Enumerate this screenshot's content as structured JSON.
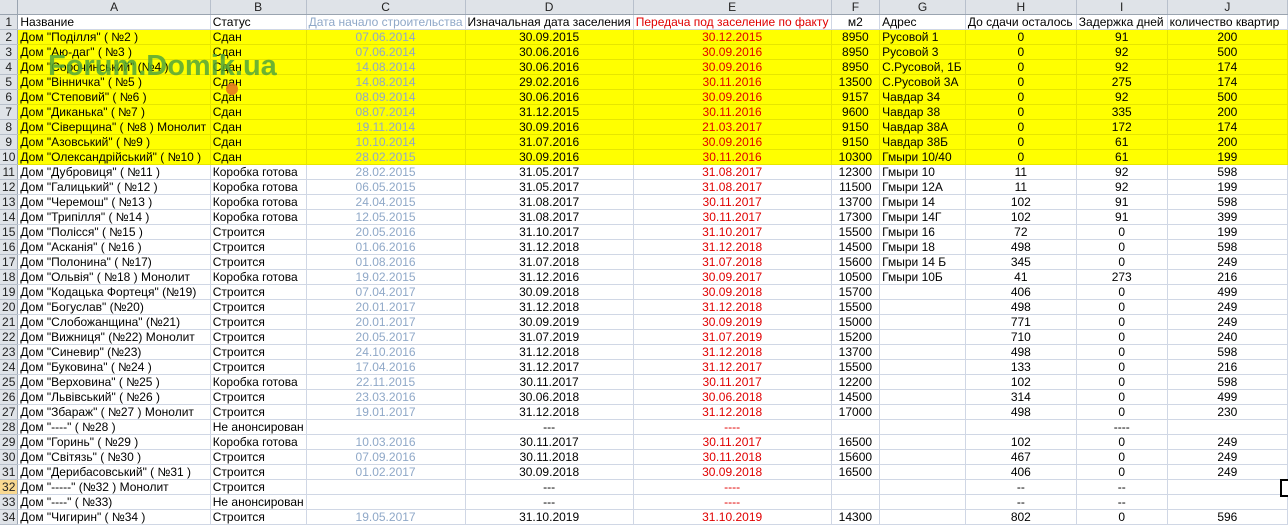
{
  "columns": [
    "A",
    "B",
    "C",
    "D",
    "E",
    "F",
    "G",
    "H",
    "I",
    "J"
  ],
  "headers": [
    "Название",
    "Статус",
    "Дата начало строительства",
    "Изначальная дата заселения",
    "Передача под заселение по факту",
    "м2",
    "Адрес",
    "До сдачи осталось",
    "Задержка дней",
    "количество квартир"
  ],
  "watermark": "Forum.Domik.ua",
  "selected_row": 32,
  "rows": [
    {
      "n": 2,
      "name": "Дом \"Поділля\" ( №2 )",
      "status": "Сдан",
      "start": "07.06.2014",
      "plan": "30.09.2015",
      "fact": "30.12.2015",
      "m2": "8950",
      "addr": "Русовой 1",
      "left": "0",
      "delay": "91",
      "flats": "200",
      "yellow": true
    },
    {
      "n": 3,
      "name": "Дом \"Аю-даг\" ( №3 )",
      "status": "Сдан",
      "start": "07.06.2014",
      "plan": "30.06.2016",
      "fact": "30.09.2016",
      "m2": "8950",
      "addr": "Русовой 3",
      "left": "0",
      "delay": "92",
      "flats": "500",
      "yellow": true
    },
    {
      "n": 4,
      "name": "Дом \"Сорочинський\" (№4 )",
      "status": "Сдан",
      "start": "14.08.2014",
      "plan": "30.06.2016",
      "fact": "30.09.2016",
      "m2": "8950",
      "addr": "С.Русовой, 1Б",
      "left": "0",
      "delay": "92",
      "flats": "174",
      "yellow": true
    },
    {
      "n": 5,
      "name": "Дом \"Вінничка\" ( №5 )",
      "status": "Сдан",
      "start": "14.08.2014",
      "plan": "29.02.2016",
      "fact": "30.11.2016",
      "m2": "13500",
      "addr": "С.Русовой 3А",
      "left": "0",
      "delay": "275",
      "flats": "174",
      "yellow": true
    },
    {
      "n": 6,
      "name": "Дом \"Степовий\" ( №6 )",
      "status": "Сдан",
      "start": "08.09.2014",
      "plan": "30.06.2016",
      "fact": "30.09.2016",
      "m2": "9157",
      "addr": "Чавдар 34",
      "left": "0",
      "delay": "92",
      "flats": "500",
      "yellow": true
    },
    {
      "n": 7,
      "name": "Дом \"Диканька\" ( №7 )",
      "status": "Сдан",
      "start": "08.07.2014",
      "plan": "31.12.2015",
      "fact": "30.11.2016",
      "m2": "9600",
      "addr": "Чавдар 38",
      "left": "0",
      "delay": "335",
      "flats": "200",
      "yellow": true
    },
    {
      "n": 8,
      "name": "Дом \"Сіверщина\" ( №8 ) Монолит",
      "status": "Сдан",
      "start": "19.11.2014",
      "plan": "30.09.2016",
      "fact": "21.03.2017",
      "m2": "9150",
      "addr": "Чавдар 38А",
      "left": "0",
      "delay": "172",
      "flats": "174",
      "yellow": true
    },
    {
      "n": 9,
      "name": "Дом \"Азовський\" ( №9 )",
      "status": "Сдан",
      "start": "10.10.2014",
      "plan": "31.07.2016",
      "fact": "30.09.2016",
      "m2": "9150",
      "addr": "Чавдар 38Б",
      "left": "0",
      "delay": "61",
      "flats": "200",
      "yellow": true
    },
    {
      "n": 10,
      "name": "Дом \"Олександрійський\" ( №10 )",
      "status": "Сдан",
      "start": "28.02.2015",
      "plan": "30.09.2016",
      "fact": "30.11.2016",
      "m2": "10300",
      "addr": "Гмыри 10/40",
      "left": "0",
      "delay": "61",
      "flats": "199",
      "yellow": true
    },
    {
      "n": 11,
      "name": "Дом \"Дубровиця\" ( №11 )",
      "status": "Коробка готова",
      "start": "28.02.2015",
      "plan": "31.05.2017",
      "fact": "31.08.2017",
      "m2": "12300",
      "addr": "Гмыри 10",
      "left": "11",
      "delay": "92",
      "flats": "598",
      "yellow": false
    },
    {
      "n": 12,
      "name": "Дом \"Галицький\" ( №12 )",
      "status": "Коробка готова",
      "start": "06.05.2015",
      "plan": "31.05.2017",
      "fact": "31.08.2017",
      "m2": "11500",
      "addr": "Гмыри 12А",
      "left": "11",
      "delay": "92",
      "flats": "199",
      "yellow": false
    },
    {
      "n": 13,
      "name": "Дом \"Черемош\" ( №13 )",
      "status": "Коробка готова",
      "start": "24.04.2015",
      "plan": "31.08.2017",
      "fact": "30.11.2017",
      "m2": "13700",
      "addr": "Гмыри 14",
      "left": "102",
      "delay": "91",
      "flats": "598",
      "yellow": false
    },
    {
      "n": 14,
      "name": "Дом \"Трипілля\" ( №14 )",
      "status": "Коробка готова",
      "start": "12.05.2015",
      "plan": "31.08.2017",
      "fact": "30.11.2017",
      "m2": "17300",
      "addr": "Гмыри 14Г",
      "left": "102",
      "delay": "91",
      "flats": "399",
      "yellow": false
    },
    {
      "n": 15,
      "name": "Дом \"Полісся\" ( №15 )",
      "status": "Строится",
      "start": "20.05.2016",
      "plan": "31.10.2017",
      "fact": "31.10.2017",
      "m2": "15500",
      "addr": "Гмыри 16",
      "left": "72",
      "delay": "0",
      "flats": "199",
      "yellow": false
    },
    {
      "n": 16,
      "name": "Дом \"Асканія\" ( №16 )",
      "status": "Строится",
      "start": "01.06.2016",
      "plan": "31.12.2018",
      "fact": "31.12.2018",
      "m2": "14500",
      "addr": "Гмыри 18",
      "left": "498",
      "delay": "0",
      "flats": "598",
      "yellow": false
    },
    {
      "n": 17,
      "name": "Дом \"Полонина\" ( №17)",
      "status": "Строится",
      "start": "01.08.2016",
      "plan": "31.07.2018",
      "fact": "31.07.2018",
      "m2": "15600",
      "addr": "Гмыри 14 Б",
      "left": "345",
      "delay": "0",
      "flats": "249",
      "yellow": false
    },
    {
      "n": 18,
      "name": "Дом \"Ольвія\" ( №18 ) Монолит",
      "status": "Коробка готова",
      "start": "19.02.2015",
      "plan": "31.12.2016",
      "fact": "30.09.2017",
      "m2": "10500",
      "addr": "Гмыри 10Б",
      "left": "41",
      "delay": "273",
      "flats": "216",
      "yellow": false
    },
    {
      "n": 19,
      "name": "Дом \"Кодацька Фортеця\" (№19)",
      "status": "Строится",
      "start": "07.04.2017",
      "plan": "30.09.2018",
      "fact": "30.09.2018",
      "m2": "15700",
      "addr": "",
      "left": "406",
      "delay": "0",
      "flats": "499",
      "yellow": false
    },
    {
      "n": 20,
      "name": "Дом \"Богуслав\" (№20)",
      "status": "Строится",
      "start": "20.01.2017",
      "plan": "31.12.2018",
      "fact": "31.12.2018",
      "m2": "15500",
      "addr": "",
      "left": "498",
      "delay": "0",
      "flats": "249",
      "yellow": false
    },
    {
      "n": 21,
      "name": "Дом \"Слобожанщина\" (№21)",
      "status": "Строится",
      "start": "20.01.2017",
      "plan": "30.09.2019",
      "fact": "30.09.2019",
      "m2": "15000",
      "addr": "",
      "left": "771",
      "delay": "0",
      "flats": "249",
      "yellow": false
    },
    {
      "n": 22,
      "name": "Дом \"Вижниця\" (№22) Монолит",
      "status": "Строится",
      "start": "20.05.2017",
      "plan": "31.07.2019",
      "fact": "31.07.2019",
      "m2": "15200",
      "addr": "",
      "left": "710",
      "delay": "0",
      "flats": "240",
      "yellow": false
    },
    {
      "n": 23,
      "name": "Дом \"Синевир\" (№23)",
      "status": "Строится",
      "start": "24.10.2016",
      "plan": "31.12.2018",
      "fact": "31.12.2018",
      "m2": "13700",
      "addr": "",
      "left": "498",
      "delay": "0",
      "flats": "598",
      "yellow": false
    },
    {
      "n": 24,
      "name": "Дом \"Буковина\" ( №24 )",
      "status": "Строится",
      "start": "17.04.2016",
      "plan": "31.12.2017",
      "fact": "31.12.2017",
      "m2": "15500",
      "addr": "",
      "left": "133",
      "delay": "0",
      "flats": "216",
      "yellow": false
    },
    {
      "n": 25,
      "name": "Дом \"Верховина\" ( №25 )",
      "status": "Коробка готова",
      "start": "22.11.2015",
      "plan": "30.11.2017",
      "fact": "30.11.2017",
      "m2": "12200",
      "addr": "",
      "left": "102",
      "delay": "0",
      "flats": "598",
      "yellow": false
    },
    {
      "n": 26,
      "name": "Дом \"Львівський\" ( №26 )",
      "status": "Строится",
      "start": "23.03.2016",
      "plan": "30.06.2018",
      "fact": "30.06.2018",
      "m2": "14500",
      "addr": "",
      "left": "314",
      "delay": "0",
      "flats": "499",
      "yellow": false
    },
    {
      "n": 27,
      "name": "Дом \"Збараж\" ( №27 ) Монолит",
      "status": "Строится",
      "start": "19.01.2017",
      "plan": "31.12.2018",
      "fact": "31.12.2018",
      "m2": "17000",
      "addr": "",
      "left": "498",
      "delay": "0",
      "flats": "230",
      "yellow": false
    },
    {
      "n": 28,
      "name": "Дом \"----\" ( №28 )",
      "status": "Не анонсирован",
      "start": "",
      "plan": "---",
      "fact": "----",
      "m2": "",
      "addr": "",
      "left": "",
      "delay": "----",
      "flats": "",
      "yellow": false
    },
    {
      "n": 29,
      "name": "Дом \"Горинь\" ( №29 )",
      "status": "Коробка готова",
      "start": "10.03.2016",
      "plan": "30.11.2017",
      "fact": "30.11.2017",
      "m2": "16500",
      "addr": "",
      "left": "102",
      "delay": "0",
      "flats": "249",
      "yellow": false
    },
    {
      "n": 30,
      "name": "Дом \"Світязь\" ( №30 )",
      "status": "Строится",
      "start": "07.09.2016",
      "plan": "30.11.2018",
      "fact": "30.11.2018",
      "m2": "15600",
      "addr": "",
      "left": "467",
      "delay": "0",
      "flats": "249",
      "yellow": false
    },
    {
      "n": 31,
      "name": "Дом \"Дерибасовський\" ( №31 )",
      "status": "Строится",
      "start": "01.02.2017",
      "plan": "30.09.2018",
      "fact": "30.09.2018",
      "m2": "16500",
      "addr": "",
      "left": "406",
      "delay": "0",
      "flats": "249",
      "yellow": false
    },
    {
      "n": 32,
      "name": "Дом \"-----\" (№32 ) Монолит",
      "status": "Строится",
      "start": "",
      "plan": "---",
      "fact": "----",
      "m2": "",
      "addr": "",
      "left": "--",
      "delay": "--",
      "flats": "",
      "yellow": false
    },
    {
      "n": 33,
      "name": "Дом \"----\" ( №33)",
      "status": "Не анонсирован",
      "start": "",
      "plan": "---",
      "fact": "----",
      "m2": "",
      "addr": "",
      "left": "--",
      "delay": "--",
      "flats": "",
      "yellow": false
    },
    {
      "n": 34,
      "name": "Дом \"Чигирин\" ( №34 )",
      "status": "Строится",
      "start": "19.05.2017",
      "plan": "31.10.2019",
      "fact": "31.10.2019",
      "m2": "14300",
      "addr": "",
      "left": "802",
      "delay": "0",
      "flats": "596",
      "yellow": false
    }
  ]
}
